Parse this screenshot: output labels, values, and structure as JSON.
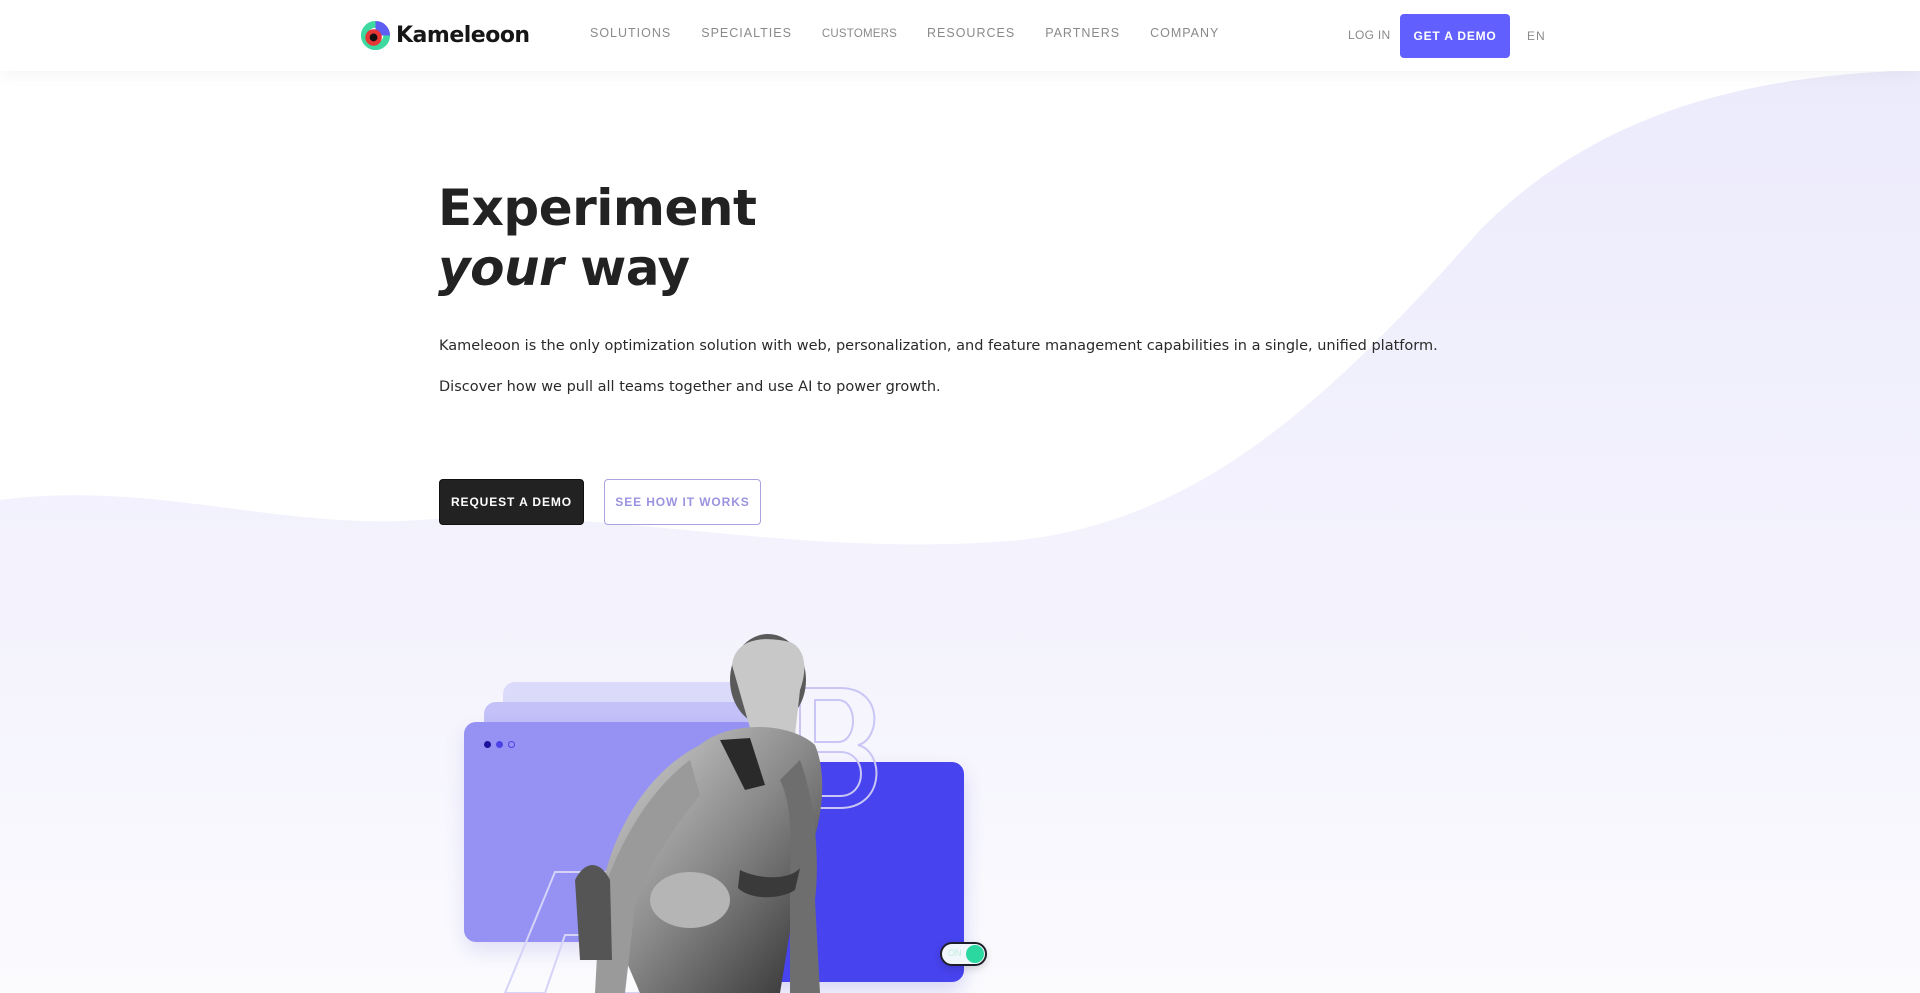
{
  "header": {
    "brand": "Kameleoon",
    "nav": [
      {
        "label": "SOLUTIONS"
      },
      {
        "label": "SPECIALTIES"
      },
      {
        "label": "CUSTOMERS"
      },
      {
        "label": "RESOURCES"
      },
      {
        "label": "PARTNERS"
      },
      {
        "label": "COMPANY"
      }
    ],
    "login_label": "LOG IN",
    "cta_label": "GET A DEMO",
    "language": "EN"
  },
  "hero": {
    "title_line1": "Experiment",
    "title_line2_em": "your",
    "title_line2_rest": " way",
    "paragraph1": "Kameleoon is the only optimization solution with web, personalization, and feature management capabilities in a single, unified platform.",
    "paragraph2": "Discover how we pull all teams together and use AI to power growth.",
    "primary_button": "REQUEST A DEMO",
    "secondary_button": "SEE HOW IT WORKS"
  },
  "illustration": {
    "letters": [
      "A",
      "B"
    ],
    "toggle_label": "ON",
    "toggle_state": "on"
  },
  "colors": {
    "brand_accent": "#6160ff",
    "dark_button": "#222222",
    "variant_a": "#9592f4",
    "variant_b": "#4743ee",
    "toggle_on": "#2bd9a0",
    "wave_fill": "#efeefc"
  }
}
